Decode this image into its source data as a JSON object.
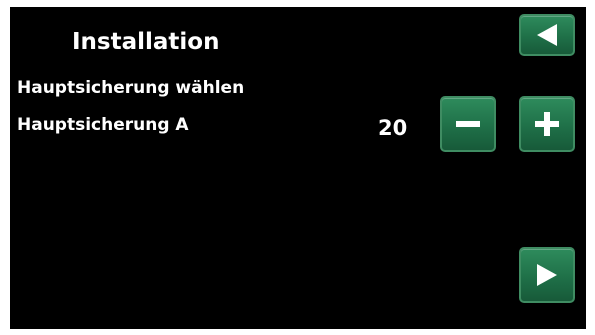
{
  "header": {
    "title": "Installation"
  },
  "main": {
    "section_label": "Hauptsicherung wählen",
    "field_label": "Hauptsicherung A",
    "field_value": "20"
  },
  "icons": {
    "back": "triangle-left-icon",
    "minus": "minus-icon",
    "plus": "plus-icon",
    "next": "triangle-right-icon"
  },
  "colors": {
    "background": "#000000",
    "text": "#ffffff",
    "button": "#1f7048",
    "button_border": "#3f8c62"
  }
}
